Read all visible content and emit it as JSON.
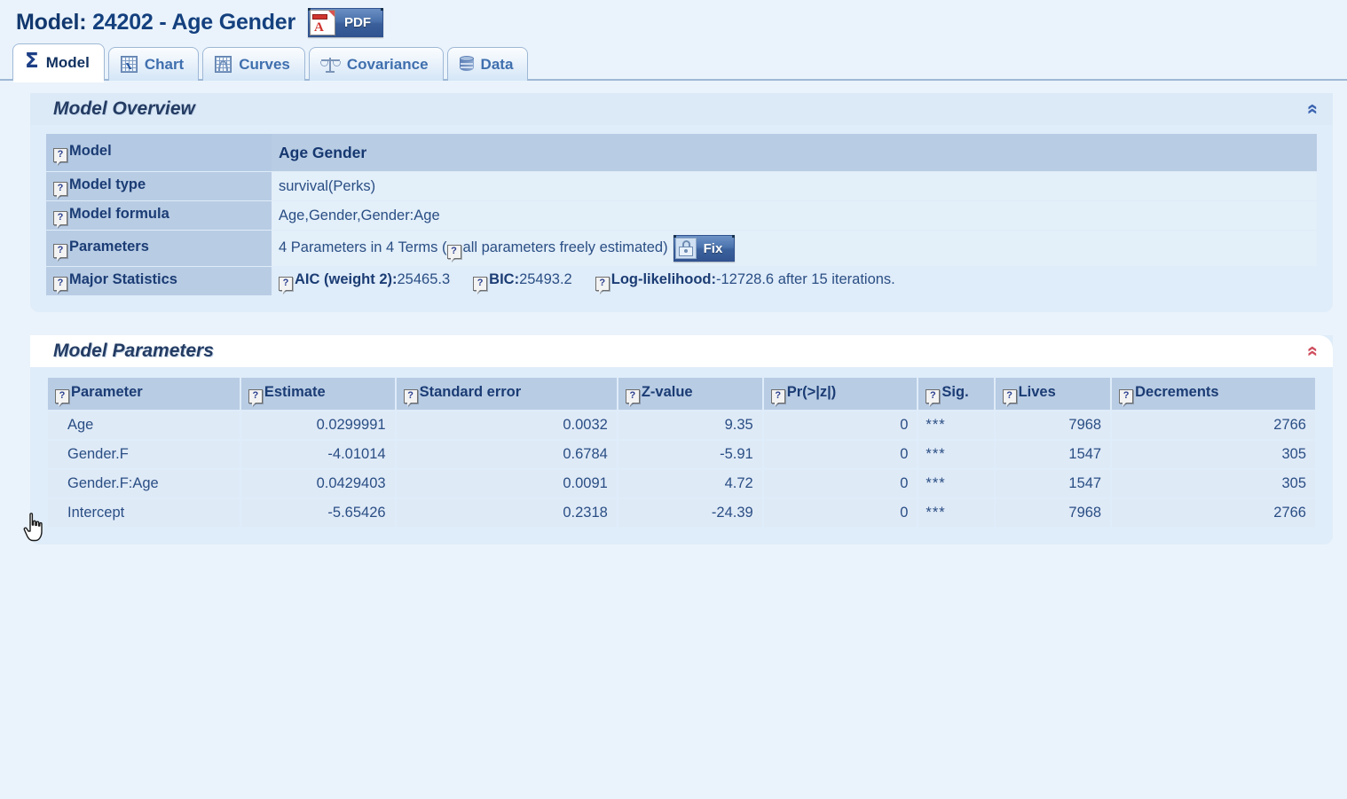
{
  "header": {
    "label": "Model:",
    "model_id": "24202",
    "separator": "-",
    "model_name": "Age Gender",
    "pdf_button_label": "PDF",
    "pdf_icon": "pdf-file-icon"
  },
  "tabs": [
    {
      "label": "Model",
      "icon": "sigma-icon",
      "active": true
    },
    {
      "label": "Chart",
      "icon": "chart-icon",
      "active": false
    },
    {
      "label": "Curves",
      "icon": "curves-icon",
      "active": false
    },
    {
      "label": "Covariance",
      "icon": "balance-scale-icon",
      "active": false
    },
    {
      "label": "Data",
      "icon": "database-icon",
      "active": false
    }
  ],
  "overview": {
    "title": "Model Overview",
    "collapse_icon": "chevron-up-double-icon",
    "collapse_color": "#3a63b0",
    "rows": [
      {
        "label": "Model",
        "value": "Age Gender"
      },
      {
        "label": "Model type",
        "value": "survival(Perks)"
      },
      {
        "label": "Model formula",
        "value": "Age,Gender,Gender:Age"
      }
    ],
    "parameters_row": {
      "label": "Parameters",
      "text_before": "4 Parameters in 4 Terms (",
      "text_inner": "all parameters freely estimated)",
      "fix_button_label": "Fix",
      "fix_icon": "padlock-icon"
    },
    "major_statistics_row": {
      "label": "Major Statistics",
      "stats": [
        {
          "name": "AIC (weight 2):",
          "value": "25465.3"
        },
        {
          "name": "BIC:",
          "value": "25493.2"
        },
        {
          "name": "Log-likelihood:",
          "value": "-12728.6 after 15 iterations."
        }
      ]
    }
  },
  "parameters_panel": {
    "title": "Model Parameters",
    "collapse_icon": "chevron-up-double-icon",
    "collapse_color": "#cf4f5f",
    "columns": [
      "Parameter",
      "Estimate",
      "Standard error",
      "Z-value",
      "Pr(>|z|)",
      "Sig.",
      "Lives",
      "Decrements"
    ],
    "rows": [
      {
        "parameter": "Age",
        "estimate": "0.0299991",
        "std_error": "0.0032",
        "z_value": "9.35",
        "p_value": "0",
        "sig": "***",
        "lives": "7968",
        "decrements": "2766"
      },
      {
        "parameter": "Gender.F",
        "estimate": "-4.01014",
        "std_error": "0.6784",
        "z_value": "-5.91",
        "p_value": "0",
        "sig": "***",
        "lives": "1547",
        "decrements": "305"
      },
      {
        "parameter": "Gender.F:Age",
        "estimate": "0.0429403",
        "std_error": "0.0091",
        "z_value": "4.72",
        "p_value": "0",
        "sig": "***",
        "lives": "1547",
        "decrements": "305"
      },
      {
        "parameter": "Intercept",
        "estimate": "-5.65426",
        "std_error": "0.2318",
        "z_value": "-24.39",
        "p_value": "0",
        "sig": "***",
        "lives": "7968",
        "decrements": "2766"
      }
    ]
  },
  "help_icon_glyph": "?",
  "colors": {
    "page_background": "#eaf3fb",
    "panel_background": "#dfecf9",
    "table_header": "#b8cce4",
    "table_row": "#dfeaf7",
    "title_text": "#12386e",
    "accent_blue": "#3a63b0",
    "accent_red": "#cf4f5f"
  }
}
